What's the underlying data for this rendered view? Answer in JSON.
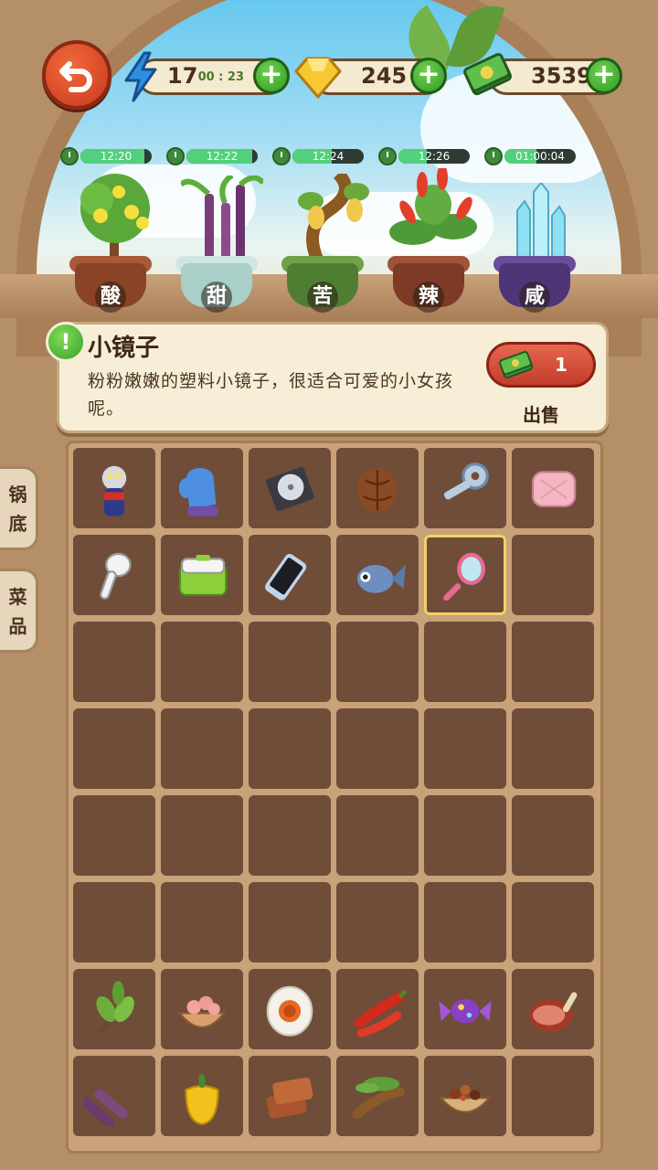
{
  "resources": {
    "energy": {
      "value": "17",
      "timer": "00 : 23",
      "icon": "lightning-icon"
    },
    "gems": {
      "value": "245",
      "icon": "gem-icon"
    },
    "cash": {
      "value": "3539",
      "icon": "cash-icon"
    },
    "plus_label": "+"
  },
  "plants": [
    {
      "label": "酸",
      "timer": "12:20",
      "progress": 0.9
    },
    {
      "label": "甜",
      "timer": "12:22",
      "progress": 0.92
    },
    {
      "label": "苦",
      "timer": "12:24",
      "progress": 0.55
    },
    {
      "label": "辣",
      "timer": "12:26",
      "progress": 0.4
    },
    {
      "label": "咸",
      "timer": "01:00:04",
      "progress": 0.45
    }
  ],
  "info": {
    "badge": "!",
    "name": "小镜子",
    "description": "粉粉嫩嫩的塑料小镜子，很适合可爱的小女孩呢。",
    "sell_price": "1",
    "sell_label": "出售"
  },
  "side_tabs": [
    {
      "label": "锅底"
    },
    {
      "label": "菜品"
    }
  ],
  "inventory": [
    [
      "ultraman-figure",
      "blue-mitten",
      "cd-case",
      "walnut",
      "key",
      "pink-pillow"
    ],
    [
      "earbud",
      "lunch-box",
      "smartphone",
      "fish",
      "pink-mirror",
      ""
    ],
    [
      "",
      "",
      "",
      "",
      "",
      ""
    ],
    [
      "",
      "",
      "",
      "",
      "",
      ""
    ],
    [
      "",
      "",
      "",
      "",
      "",
      ""
    ],
    [
      "",
      "",
      "",
      "",
      "",
      ""
    ],
    [
      "tea-leaves",
      "shrimp-bowl",
      "salted-egg",
      "red-chili",
      "purple-candy",
      "ham-leg"
    ],
    [
      "sugarcane",
      "yellow-pepper",
      "tofu-slices",
      "tamarind",
      "spice-bowl",
      ""
    ]
  ],
  "selected_item": "pink-mirror"
}
